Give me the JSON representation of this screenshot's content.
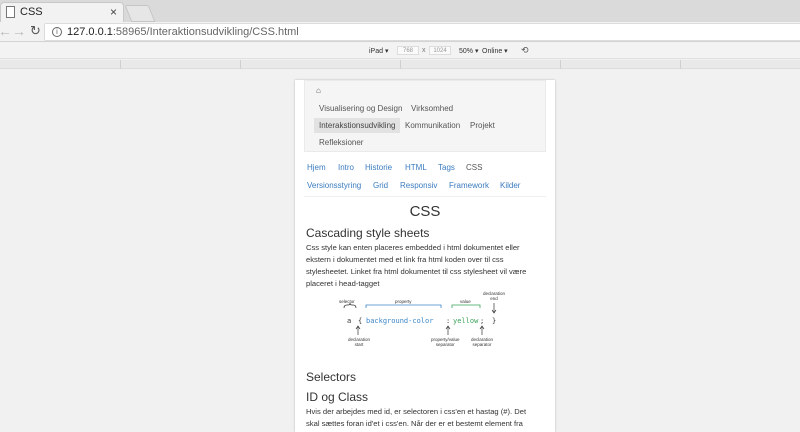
{
  "browser": {
    "tab_title": "CSS",
    "tab_close": "×",
    "url_host": "127.0.0.1",
    "url_rest": ":58965/Interaktionsudvikling/CSS.html"
  },
  "device_toolbar": {
    "device": "iPad ▾",
    "width": "768",
    "x": "x",
    "height": "1024",
    "zoom": "50% ▾",
    "network": "Online ▾"
  },
  "site_nav": {
    "items": [
      "Visualisering og Design",
      "Virksomhed",
      "Interakstionsudvikling",
      "Kommunikation",
      "Projekt",
      "Refleksioner"
    ],
    "active": "Interakstionsudvikling"
  },
  "sub_nav": {
    "items": [
      "Hjem",
      "Intro",
      "Historie",
      "HTML",
      "Tags",
      "CSS",
      "Versionsstyring",
      "Grid",
      "Responsiv",
      "Framework",
      "Kilder"
    ],
    "current": "CSS"
  },
  "page": {
    "title": "CSS",
    "heading1": "Cascading style sheets",
    "para1_lines": [
      "Css style kan enten placeres embedded i html dokumentet eller",
      "ekstern i dokumentet med et link fra html koden over til css",
      "stylesheetet. Linket fra html dokumentet til css stylesheet vil være",
      "placeret i head-tagget"
    ],
    "heading2": "Selectors",
    "heading3": "ID og Class",
    "para2_lines": [
      "Hvis der arbejdes med id, er selectoren i css'en et hastag (#). Det",
      "skal sættes foran id'et i css'en. Når der er et bestemt element fra"
    ]
  },
  "diagram": {
    "selector_label": "selector",
    "property_label": "property",
    "value_label": "value",
    "decl_end_label": "declaration\nend",
    "selector": "a",
    "open_brace": "{",
    "property": "background-color",
    "colon": ":",
    "value": "yellow",
    "semicolon": ";",
    "close_brace": "}",
    "decl_start_label": "declaration\nstart",
    "pv_sep_label": "property/value\nseparator",
    "decl_sep_label": "declaration\nseparator",
    "colors": {
      "property": "#3b86c8",
      "value": "#3aa25a"
    }
  }
}
